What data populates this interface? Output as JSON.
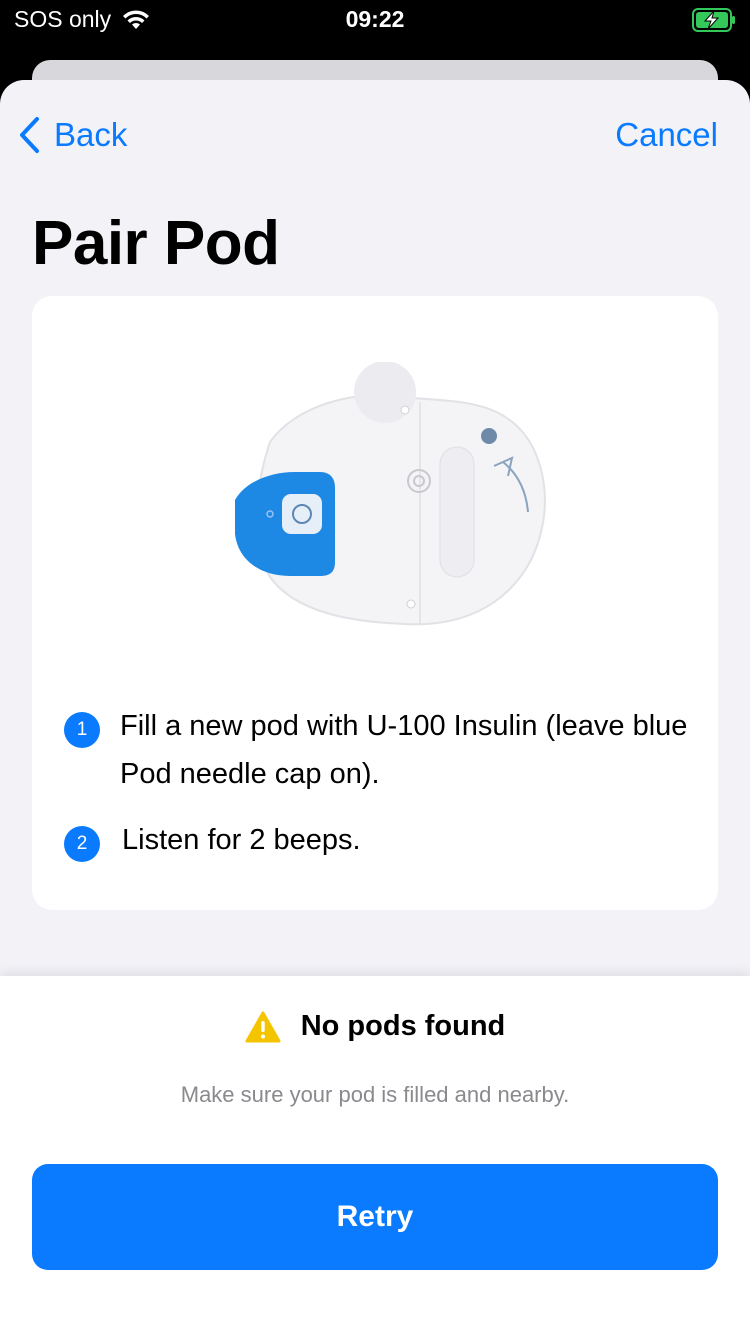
{
  "status_bar": {
    "carrier": "SOS only",
    "time": "09:22",
    "wifi_icon": "wifi-icon",
    "battery_icon": "battery-charging-icon",
    "battery_color": "#34c759"
  },
  "nav": {
    "back_label": "Back",
    "cancel_label": "Cancel",
    "accent_color": "#0a7aff"
  },
  "page": {
    "title": "Pair Pod"
  },
  "card": {
    "image_icon": "pod-illustration",
    "steps": [
      {
        "number": "1",
        "text": "Fill a new pod with U-100 Insulin (leave blue Pod needle cap on)."
      },
      {
        "number": "2",
        "text": "Listen for 2 beeps."
      }
    ]
  },
  "alert": {
    "icon": "warning-icon",
    "title": "No pods found",
    "message": "Make sure your pod is filled and nearby.",
    "warning_color": "#f5c400"
  },
  "actions": {
    "retry_label": "Retry"
  }
}
